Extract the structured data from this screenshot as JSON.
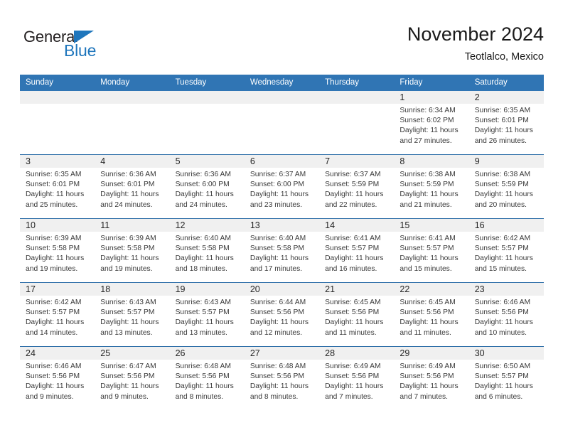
{
  "logo": {
    "word_top": "General",
    "word_bottom": "Blue",
    "triangle_icon": "logo-triangle-icon",
    "color_dark": "#231f20",
    "color_blue": "#1f76bc"
  },
  "header": {
    "title": "November 2024",
    "subtitle": "Teotlalco, Mexico"
  },
  "colors": {
    "header_blue": "#3075b4",
    "row_divider_blue": "#2e6fa8",
    "daynum_band": "#f0f0f0",
    "text": "#3a3a3a"
  },
  "weekday_headers": [
    "Sunday",
    "Monday",
    "Tuesday",
    "Wednesday",
    "Thursday",
    "Friday",
    "Saturday"
  ],
  "weeks": [
    [
      {
        "day": "",
        "sunrise": "",
        "sunset": "",
        "daylight_1": "",
        "daylight_2": ""
      },
      {
        "day": "",
        "sunrise": "",
        "sunset": "",
        "daylight_1": "",
        "daylight_2": ""
      },
      {
        "day": "",
        "sunrise": "",
        "sunset": "",
        "daylight_1": "",
        "daylight_2": ""
      },
      {
        "day": "",
        "sunrise": "",
        "sunset": "",
        "daylight_1": "",
        "daylight_2": ""
      },
      {
        "day": "",
        "sunrise": "",
        "sunset": "",
        "daylight_1": "",
        "daylight_2": ""
      },
      {
        "day": "1",
        "sunrise": "Sunrise: 6:34 AM",
        "sunset": "Sunset: 6:02 PM",
        "daylight_1": "Daylight: 11 hours",
        "daylight_2": "and 27 minutes."
      },
      {
        "day": "2",
        "sunrise": "Sunrise: 6:35 AM",
        "sunset": "Sunset: 6:01 PM",
        "daylight_1": "Daylight: 11 hours",
        "daylight_2": "and 26 minutes."
      }
    ],
    [
      {
        "day": "3",
        "sunrise": "Sunrise: 6:35 AM",
        "sunset": "Sunset: 6:01 PM",
        "daylight_1": "Daylight: 11 hours",
        "daylight_2": "and 25 minutes."
      },
      {
        "day": "4",
        "sunrise": "Sunrise: 6:36 AM",
        "sunset": "Sunset: 6:01 PM",
        "daylight_1": "Daylight: 11 hours",
        "daylight_2": "and 24 minutes."
      },
      {
        "day": "5",
        "sunrise": "Sunrise: 6:36 AM",
        "sunset": "Sunset: 6:00 PM",
        "daylight_1": "Daylight: 11 hours",
        "daylight_2": "and 24 minutes."
      },
      {
        "day": "6",
        "sunrise": "Sunrise: 6:37 AM",
        "sunset": "Sunset: 6:00 PM",
        "daylight_1": "Daylight: 11 hours",
        "daylight_2": "and 23 minutes."
      },
      {
        "day": "7",
        "sunrise": "Sunrise: 6:37 AM",
        "sunset": "Sunset: 5:59 PM",
        "daylight_1": "Daylight: 11 hours",
        "daylight_2": "and 22 minutes."
      },
      {
        "day": "8",
        "sunrise": "Sunrise: 6:38 AM",
        "sunset": "Sunset: 5:59 PM",
        "daylight_1": "Daylight: 11 hours",
        "daylight_2": "and 21 minutes."
      },
      {
        "day": "9",
        "sunrise": "Sunrise: 6:38 AM",
        "sunset": "Sunset: 5:59 PM",
        "daylight_1": "Daylight: 11 hours",
        "daylight_2": "and 20 minutes."
      }
    ],
    [
      {
        "day": "10",
        "sunrise": "Sunrise: 6:39 AM",
        "sunset": "Sunset: 5:58 PM",
        "daylight_1": "Daylight: 11 hours",
        "daylight_2": "and 19 minutes."
      },
      {
        "day": "11",
        "sunrise": "Sunrise: 6:39 AM",
        "sunset": "Sunset: 5:58 PM",
        "daylight_1": "Daylight: 11 hours",
        "daylight_2": "and 19 minutes."
      },
      {
        "day": "12",
        "sunrise": "Sunrise: 6:40 AM",
        "sunset": "Sunset: 5:58 PM",
        "daylight_1": "Daylight: 11 hours",
        "daylight_2": "and 18 minutes."
      },
      {
        "day": "13",
        "sunrise": "Sunrise: 6:40 AM",
        "sunset": "Sunset: 5:58 PM",
        "daylight_1": "Daylight: 11 hours",
        "daylight_2": "and 17 minutes."
      },
      {
        "day": "14",
        "sunrise": "Sunrise: 6:41 AM",
        "sunset": "Sunset: 5:57 PM",
        "daylight_1": "Daylight: 11 hours",
        "daylight_2": "and 16 minutes."
      },
      {
        "day": "15",
        "sunrise": "Sunrise: 6:41 AM",
        "sunset": "Sunset: 5:57 PM",
        "daylight_1": "Daylight: 11 hours",
        "daylight_2": "and 15 minutes."
      },
      {
        "day": "16",
        "sunrise": "Sunrise: 6:42 AM",
        "sunset": "Sunset: 5:57 PM",
        "daylight_1": "Daylight: 11 hours",
        "daylight_2": "and 15 minutes."
      }
    ],
    [
      {
        "day": "17",
        "sunrise": "Sunrise: 6:42 AM",
        "sunset": "Sunset: 5:57 PM",
        "daylight_1": "Daylight: 11 hours",
        "daylight_2": "and 14 minutes."
      },
      {
        "day": "18",
        "sunrise": "Sunrise: 6:43 AM",
        "sunset": "Sunset: 5:57 PM",
        "daylight_1": "Daylight: 11 hours",
        "daylight_2": "and 13 minutes."
      },
      {
        "day": "19",
        "sunrise": "Sunrise: 6:43 AM",
        "sunset": "Sunset: 5:57 PM",
        "daylight_1": "Daylight: 11 hours",
        "daylight_2": "and 13 minutes."
      },
      {
        "day": "20",
        "sunrise": "Sunrise: 6:44 AM",
        "sunset": "Sunset: 5:56 PM",
        "daylight_1": "Daylight: 11 hours",
        "daylight_2": "and 12 minutes."
      },
      {
        "day": "21",
        "sunrise": "Sunrise: 6:45 AM",
        "sunset": "Sunset: 5:56 PM",
        "daylight_1": "Daylight: 11 hours",
        "daylight_2": "and 11 minutes."
      },
      {
        "day": "22",
        "sunrise": "Sunrise: 6:45 AM",
        "sunset": "Sunset: 5:56 PM",
        "daylight_1": "Daylight: 11 hours",
        "daylight_2": "and 11 minutes."
      },
      {
        "day": "23",
        "sunrise": "Sunrise: 6:46 AM",
        "sunset": "Sunset: 5:56 PM",
        "daylight_1": "Daylight: 11 hours",
        "daylight_2": "and 10 minutes."
      }
    ],
    [
      {
        "day": "24",
        "sunrise": "Sunrise: 6:46 AM",
        "sunset": "Sunset: 5:56 PM",
        "daylight_1": "Daylight: 11 hours",
        "daylight_2": "and 9 minutes."
      },
      {
        "day": "25",
        "sunrise": "Sunrise: 6:47 AM",
        "sunset": "Sunset: 5:56 PM",
        "daylight_1": "Daylight: 11 hours",
        "daylight_2": "and 9 minutes."
      },
      {
        "day": "26",
        "sunrise": "Sunrise: 6:48 AM",
        "sunset": "Sunset: 5:56 PM",
        "daylight_1": "Daylight: 11 hours",
        "daylight_2": "and 8 minutes."
      },
      {
        "day": "27",
        "sunrise": "Sunrise: 6:48 AM",
        "sunset": "Sunset: 5:56 PM",
        "daylight_1": "Daylight: 11 hours",
        "daylight_2": "and 8 minutes."
      },
      {
        "day": "28",
        "sunrise": "Sunrise: 6:49 AM",
        "sunset": "Sunset: 5:56 PM",
        "daylight_1": "Daylight: 11 hours",
        "daylight_2": "and 7 minutes."
      },
      {
        "day": "29",
        "sunrise": "Sunrise: 6:49 AM",
        "sunset": "Sunset: 5:56 PM",
        "daylight_1": "Daylight: 11 hours",
        "daylight_2": "and 7 minutes."
      },
      {
        "day": "30",
        "sunrise": "Sunrise: 6:50 AM",
        "sunset": "Sunset: 5:57 PM",
        "daylight_1": "Daylight: 11 hours",
        "daylight_2": "and 6 minutes."
      }
    ]
  ]
}
